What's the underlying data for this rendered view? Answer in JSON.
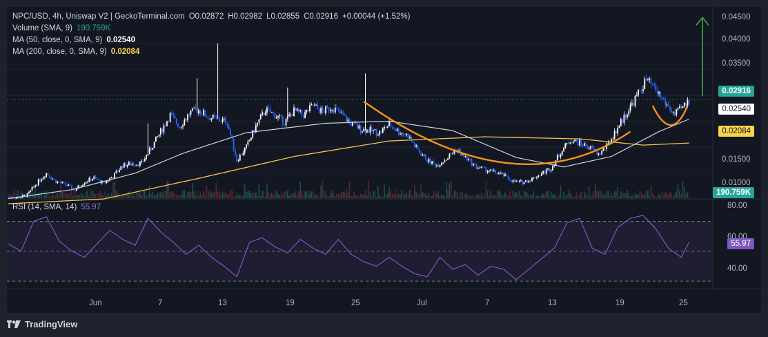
{
  "header": {
    "symbol": "NPC/USD, 4h, Uniswap V2 | GeckoTerminal.com",
    "o_label": "O",
    "o_value": "0.02872",
    "h_label": "H",
    "h_value": "0.02982",
    "l_label": "L",
    "l_value": "0.02855",
    "c_label": "C",
    "c_value": "0.02916",
    "change": "+0.00044 (+1.52%)"
  },
  "indicators": {
    "volume_label": "Volume (SMA, 9)",
    "volume_value": "190.759K",
    "ma50_label": "MA (50, close, 0, SMA, 9)",
    "ma50_value": "0.02540",
    "ma200_label": "MA (200, close, 0, SMA, 9)",
    "ma200_value": "0.02084",
    "rsi_label": "RSI (14, SMA, 14)",
    "rsi_value": "55.97"
  },
  "price_axis": [
    "0.04500",
    "0.04000",
    "0.03500",
    "0.02916",
    "0.02540",
    "0.02084",
    "0.01500",
    "0.01000"
  ],
  "rsi_axis": [
    "80.00",
    "60.00",
    "40.00"
  ],
  "badges": {
    "last_price": "0.02916",
    "ma50": "0.02540",
    "ma200": "0.02084",
    "volume": "190.759K",
    "rsi": "55.97"
  },
  "dates": [
    "Jun",
    "7",
    "13",
    "19",
    "25",
    "Jul",
    "7",
    "13",
    "19",
    "25"
  ],
  "footer": {
    "brand": "TradingView"
  },
  "colors": {
    "up": "#ffffff",
    "down": "#2962ff",
    "ma50": "#d1d4dc",
    "ma200": "#f7c948",
    "cup": "#f7931a",
    "arrow": "#4caf50",
    "rsi": "#7e57c2",
    "last_price": "#26a69a"
  },
  "chart_data": {
    "type": "candlestick",
    "title": "NPC/USD, 4h, Uniswap V2",
    "ylim": [
      0.0095,
      0.0465
    ],
    "rsi_ylim": [
      25,
      85
    ],
    "x_tick_labels": [
      "Jun",
      "7",
      "13",
      "19",
      "25",
      "Jul",
      "7",
      "13",
      "19",
      "25"
    ],
    "close_path": [
      [
        0,
        0.0104
      ],
      [
        6,
        0.0102
      ],
      [
        12,
        0.0108
      ],
      [
        18,
        0.0131
      ],
      [
        24,
        0.015
      ],
      [
        30,
        0.0134
      ],
      [
        36,
        0.0128
      ],
      [
        42,
        0.0118
      ],
      [
        48,
        0.0133
      ],
      [
        54,
        0.0141
      ],
      [
        60,
        0.013
      ],
      [
        66,
        0.0144
      ],
      [
        72,
        0.0165
      ],
      [
        78,
        0.0168
      ],
      [
        84,
        0.0169
      ],
      [
        90,
        0.0198
      ],
      [
        96,
        0.023
      ],
      [
        102,
        0.0262
      ],
      [
        108,
        0.024
      ],
      [
        114,
        0.0265
      ],
      [
        120,
        0.0272
      ],
      [
        126,
        0.0258
      ],
      [
        132,
        0.0254
      ],
      [
        138,
        0.0248
      ],
      [
        144,
        0.0175
      ],
      [
        150,
        0.02
      ],
      [
        156,
        0.024
      ],
      [
        162,
        0.0272
      ],
      [
        168,
        0.0262
      ],
      [
        174,
        0.0248
      ],
      [
        180,
        0.027
      ],
      [
        186,
        0.0262
      ],
      [
        192,
        0.028
      ],
      [
        198,
        0.0268
      ],
      [
        204,
        0.0278
      ],
      [
        210,
        0.0262
      ],
      [
        216,
        0.0246
      ],
      [
        222,
        0.0235
      ],
      [
        228,
        0.0232
      ],
      [
        234,
        0.0228
      ],
      [
        240,
        0.0244
      ],
      [
        246,
        0.023
      ],
      [
        252,
        0.0222
      ],
      [
        258,
        0.0194
      ],
      [
        264,
        0.0175
      ],
      [
        270,
        0.0165
      ],
      [
        276,
        0.0178
      ],
      [
        282,
        0.0196
      ],
      [
        288,
        0.018
      ],
      [
        294,
        0.0164
      ],
      [
        300,
        0.0157
      ],
      [
        306,
        0.0152
      ],
      [
        312,
        0.0146
      ],
      [
        318,
        0.0134
      ],
      [
        324,
        0.0132
      ],
      [
        330,
        0.0139
      ],
      [
        336,
        0.0149
      ],
      [
        342,
        0.016
      ],
      [
        348,
        0.019
      ],
      [
        354,
        0.0214
      ],
      [
        360,
        0.0208
      ],
      [
        366,
        0.02
      ],
      [
        372,
        0.0186
      ],
      [
        378,
        0.0205
      ],
      [
        384,
        0.0238
      ],
      [
        390,
        0.0268
      ],
      [
        396,
        0.0298
      ],
      [
        402,
        0.033
      ],
      [
        408,
        0.031
      ],
      [
        414,
        0.0285
      ],
      [
        420,
        0.0262
      ],
      [
        426,
        0.028
      ],
      [
        429,
        0.0291
      ]
    ],
    "series": [
      {
        "name": "MA (50, close, 0, SMA, 9)",
        "path": [
          [
            0,
            0.0101
          ],
          [
            40,
            0.0118
          ],
          [
            80,
            0.015
          ],
          [
            110,
            0.0188
          ],
          [
            150,
            0.0228
          ],
          [
            200,
            0.0246
          ],
          [
            240,
            0.025
          ],
          [
            280,
            0.0232
          ],
          [
            320,
            0.018
          ],
          [
            350,
            0.0162
          ],
          [
            380,
            0.0182
          ],
          [
            410,
            0.023
          ],
          [
            429,
            0.0254
          ]
        ]
      },
      {
        "name": "MA (200, close, 0, SMA, 9)",
        "path": [
          [
            0,
            0.0091
          ],
          [
            60,
            0.01
          ],
          [
            120,
            0.014
          ],
          [
            180,
            0.0182
          ],
          [
            240,
            0.0212
          ],
          [
            300,
            0.022
          ],
          [
            360,
            0.0216
          ],
          [
            400,
            0.0204
          ],
          [
            429,
            0.0208
          ]
        ]
      }
    ],
    "rsi_path": [
      [
        0,
        55
      ],
      [
        8,
        50
      ],
      [
        16,
        70
      ],
      [
        24,
        73
      ],
      [
        32,
        57
      ],
      [
        40,
        50
      ],
      [
        48,
        46
      ],
      [
        56,
        55
      ],
      [
        64,
        64
      ],
      [
        72,
        58
      ],
      [
        80,
        54
      ],
      [
        88,
        72
      ],
      [
        96,
        63
      ],
      [
        104,
        56
      ],
      [
        112,
        48
      ],
      [
        120,
        54
      ],
      [
        128,
        46
      ],
      [
        136,
        40
      ],
      [
        144,
        33
      ],
      [
        152,
        56
      ],
      [
        160,
        59
      ],
      [
        168,
        53
      ],
      [
        176,
        49
      ],
      [
        184,
        58
      ],
      [
        192,
        52
      ],
      [
        200,
        48
      ],
      [
        208,
        58
      ],
      [
        216,
        48
      ],
      [
        224,
        43
      ],
      [
        232,
        40
      ],
      [
        240,
        46
      ],
      [
        248,
        40
      ],
      [
        256,
        35
      ],
      [
        264,
        33
      ],
      [
        272,
        46
      ],
      [
        280,
        38
      ],
      [
        288,
        41
      ],
      [
        296,
        34
      ],
      [
        304,
        40
      ],
      [
        312,
        38
      ],
      [
        320,
        31
      ],
      [
        328,
        38
      ],
      [
        336,
        45
      ],
      [
        344,
        52
      ],
      [
        352,
        69
      ],
      [
        360,
        72
      ],
      [
        368,
        52
      ],
      [
        376,
        48
      ],
      [
        384,
        66
      ],
      [
        392,
        72
      ],
      [
        400,
        74
      ],
      [
        408,
        65
      ],
      [
        416,
        52
      ],
      [
        424,
        46
      ],
      [
        429,
        56
      ]
    ],
    "annotations": [
      "cup and handle curve",
      "upward arrow target"
    ]
  }
}
